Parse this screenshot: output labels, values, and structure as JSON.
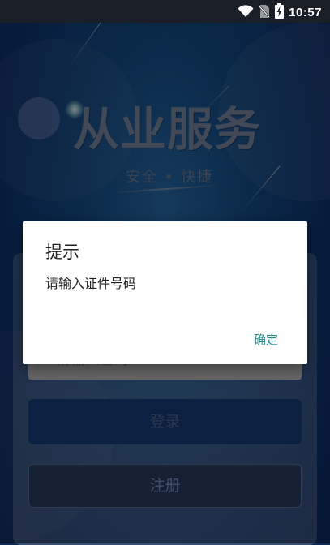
{
  "status_bar": {
    "time": "10:57",
    "icons": [
      "wifi-icon",
      "no-sim-icon",
      "battery-charging-icon"
    ]
  },
  "hero": {
    "title": "从业服务",
    "slogan": "安全 • 快捷"
  },
  "login": {
    "password_placeholder": "请输入密码",
    "login_label": "登录",
    "register_label": "注册"
  },
  "dialog": {
    "title": "提示",
    "message": "请输入证件号码",
    "confirm_label": "确定"
  },
  "colors": {
    "accent": "#1f8a8a",
    "background": "#164f8e"
  }
}
